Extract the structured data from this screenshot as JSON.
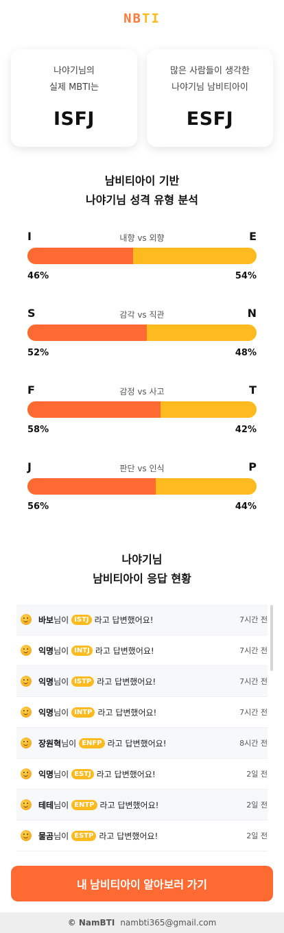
{
  "logo": {
    "first": "NB",
    "second": "TI"
  },
  "cards": [
    {
      "line1": "나야기님의",
      "line2": "실제 MBTI는",
      "type": "ISFJ"
    },
    {
      "line1": "많은 사람들이 생각한",
      "line2": "나야기님 남비티아이",
      "type": "ESFJ"
    }
  ],
  "analysis": {
    "title1": "남비티아이 기반",
    "title2": "나야기님 성격 유형 분석"
  },
  "dimensions": [
    {
      "left": "I",
      "right": "E",
      "label": "내향 vs 외향",
      "left_pct": "46%",
      "right_pct": "54%",
      "left_value": 46
    },
    {
      "left": "S",
      "right": "N",
      "label": "감각 vs 직관",
      "left_pct": "52%",
      "right_pct": "48%",
      "left_value": 52
    },
    {
      "left": "F",
      "right": "T",
      "label": "감정 vs 사고",
      "left_pct": "58%",
      "right_pct": "42%",
      "left_value": 58
    },
    {
      "left": "J",
      "right": "P",
      "label": "판단 vs 인식",
      "left_pct": "56%",
      "right_pct": "44%",
      "left_value": 56
    }
  ],
  "responses": {
    "title1": "나야기님",
    "title2": "남비티아이 응답 현황",
    "suffix": "님이",
    "said": "라고 답변했어요!",
    "items": [
      {
        "name": "바보",
        "type": "ISTJ",
        "time": "7시간 전"
      },
      {
        "name": "익명",
        "type": "INTJ",
        "time": "7시간 전"
      },
      {
        "name": "익명",
        "type": "ISTP",
        "time": "7시간 전"
      },
      {
        "name": "익명",
        "type": "INTP",
        "time": "7시간 전"
      },
      {
        "name": "장원혁",
        "type": "ENFP",
        "time": "8시간 전"
      },
      {
        "name": "익명",
        "type": "ESTJ",
        "time": "2일 전"
      },
      {
        "name": "테테",
        "type": "ENTP",
        "time": "2일 전"
      },
      {
        "name": "물곰",
        "type": "ESTP",
        "time": "2일 전"
      }
    ]
  },
  "cta_label": "내 남비티아이 알아보러 가기",
  "footer": {
    "copyright": "© NamBTI",
    "email": "nambti365@gmail.com"
  },
  "colors": {
    "accent": "#ff6a33",
    "secondary": "#ffba1f",
    "face_icon": "smiley-face-icon"
  }
}
